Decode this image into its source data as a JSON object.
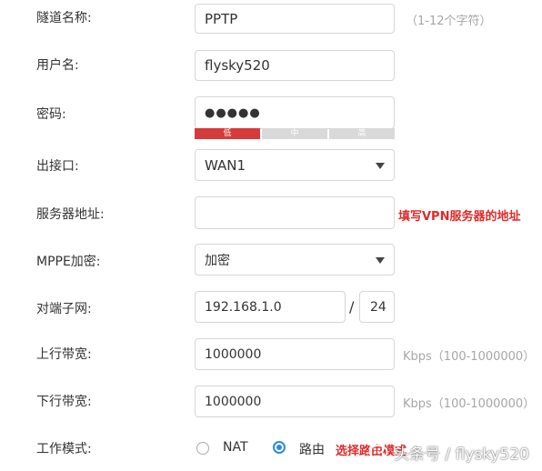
{
  "form": {
    "tunnel_name": {
      "label": "隧道名称:",
      "value": "PPTP",
      "hint": "（1-12个字符）"
    },
    "username": {
      "label": "用户名:",
      "value": "flysky520"
    },
    "password": {
      "label": "密码:",
      "value": "●●●●●",
      "strength": {
        "low": "低",
        "mid": "中",
        "high": "高",
        "level": "low"
      }
    },
    "egress": {
      "label": "出接口:",
      "value": "WAN1"
    },
    "server_address": {
      "label": "服务器地址:",
      "value": "",
      "note": "填写VPN服务器的地址"
    },
    "mppe": {
      "label": "MPPE加密:",
      "value": "加密"
    },
    "peer_subnet": {
      "label": "对端子网:",
      "ip": "192.168.1.0",
      "separator": "/",
      "mask": "24"
    },
    "upstream": {
      "label": "上行带宽:",
      "value": "1000000",
      "hint": "Kbps（100-1000000）"
    },
    "downstream": {
      "label": "下行带宽:",
      "value": "1000000",
      "hint": "Kbps（100-1000000）"
    },
    "work_mode": {
      "label": "工作模式:",
      "options": [
        {
          "label": "NAT",
          "selected": false
        },
        {
          "label": "路由",
          "selected": true
        }
      ],
      "note": "选择路由模式"
    }
  },
  "watermark": {
    "text": "头条号 / flysky520"
  },
  "colors": {
    "accent": "#2a8be0",
    "danger": "#e02a2a",
    "strength_low": "#d63b3b",
    "border": "#d6d6d6"
  }
}
